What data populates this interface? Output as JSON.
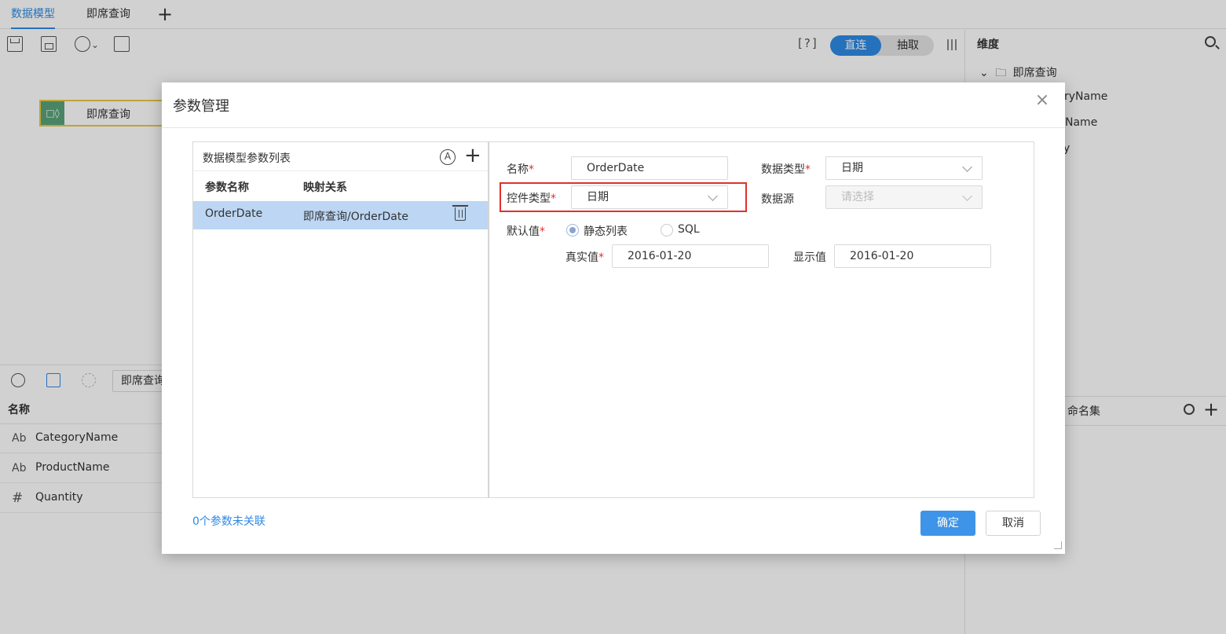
{
  "tabs": [
    {
      "label": "数据模型"
    },
    {
      "label": "即席查询"
    }
  ],
  "tab_add": "+",
  "toolbar": {
    "help": "[?]",
    "mode_on": "直连",
    "mode_off": "抽取"
  },
  "canvas": {
    "table_node": "即席查询"
  },
  "lower": {
    "select_value": "即席查询",
    "fields_header": "名称",
    "fields": [
      {
        "type": "Ab",
        "name": "CategoryName"
      },
      {
        "type": "Ab",
        "name": "ProductName"
      },
      {
        "type": "#",
        "name": "Quantity"
      }
    ]
  },
  "right_panel": {
    "title": "维度",
    "tree_root": "即席查询",
    "tree_items": [
      "ryName",
      "Name",
      "y"
    ],
    "named_sets": "命名集",
    "add": "+"
  },
  "dialog": {
    "title": "参数管理",
    "close": "×",
    "list_title": "数据模型参数列表",
    "auto_icon": "A",
    "add_icon": "+",
    "col_name": "参数名称",
    "col_mapping": "映射关系",
    "rows": [
      {
        "name": "OrderDate",
        "mapping": "即席查询/OrderDate"
      }
    ],
    "form": {
      "name_label": "名称",
      "name_value": "OrderDate",
      "datatype_label": "数据类型",
      "datatype_value": "日期",
      "control_label": "控件类型",
      "control_value": "日期",
      "source_label": "数据源",
      "source_placeholder": "请选择",
      "default_label": "默认值",
      "radio_static": "静态列表",
      "radio_sql": "SQL",
      "real_label": "真实值",
      "real_value": "2016-01-20",
      "display_label": "显示值",
      "display_value": "2016-01-20",
      "required_mark": "*"
    },
    "unlinked": "0个参数未关联",
    "ok": "确定",
    "cancel": "取消"
  }
}
